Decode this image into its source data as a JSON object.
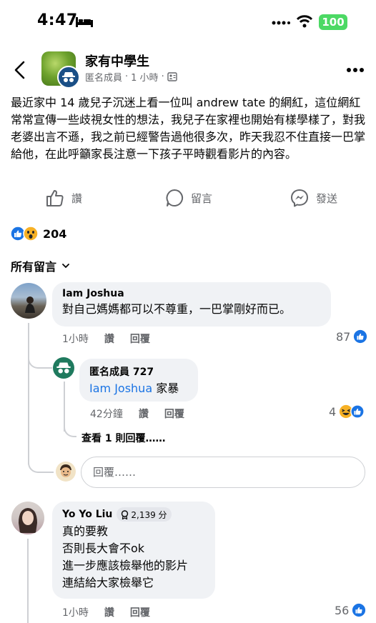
{
  "status_bar": {
    "time": "4:47",
    "battery": "100"
  },
  "post": {
    "group_name": "家有中學生",
    "author": "匿名成員",
    "time": "1 小時",
    "body": "最近家中 14 歲兒子沉迷上看一位叫 andrew tate 的網紅，這位網紅常常宣傳一些歧視女性的想法，我兒子在家裡也開始有樣學樣了，對我老婆出言不遜，我之前已經警告過他很多次，昨天我忍不住直接一巴掌給他，在此呼籲家長注意一下孩子平時觀看影片的內容。",
    "actions": {
      "like": "讚",
      "comment": "留言",
      "send": "發送"
    },
    "reaction_count": "204"
  },
  "comments_sort": "所有留言",
  "comments": [
    {
      "name": "Iam Joshua",
      "text": "對自己媽媽都可以不尊重，一巴掌剛好而已。",
      "time": "1小時",
      "like": "讚",
      "reply": "回覆",
      "likes": "87"
    },
    {
      "name": "匿名成員 727",
      "mention": "Iam Joshua",
      "text": " 家暴",
      "time": "42分鐘",
      "like": "讚",
      "reply": "回覆",
      "likes": "4"
    },
    {
      "name": "Yo Yo Liu",
      "badge": "2,139 分",
      "lines": [
        "真的要教",
        "否則長大會不ok",
        "進一步應該檢舉他的影片",
        "連結給大家檢舉它"
      ],
      "time": "1小時",
      "like": "讚",
      "reply": "回覆",
      "likes": "56"
    }
  ],
  "view_more_replies": "查看 1 則回覆……",
  "reply_placeholder": "回覆……",
  "colors": {
    "like_blue": "#1b74e4",
    "bubble": "#f0f2f5",
    "meta_gray": "#65676b"
  }
}
